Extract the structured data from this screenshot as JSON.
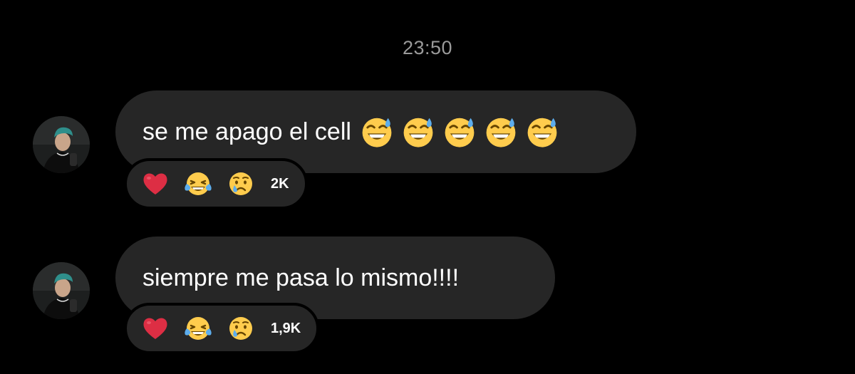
{
  "chat": {
    "timestamp": "23:50",
    "messages": [
      {
        "text": "se me apago el cell",
        "trailing_emojis": [
          "grinning-sweat",
          "grinning-sweat",
          "grinning-sweat",
          "grinning-sweat",
          "grinning-sweat"
        ],
        "reactions": [
          "red-heart",
          "tears-of-joy",
          "crying-face"
        ],
        "reaction_count": "2K"
      },
      {
        "text": "siempre me pasa lo mismo!!!!",
        "trailing_emojis": [],
        "reactions": [
          "red-heart",
          "tears-of-joy",
          "crying-face"
        ],
        "reaction_count": "1,9K"
      }
    ]
  },
  "colors": {
    "background": "#000000",
    "bubble": "#262626",
    "timestamp": "#9a9a9a",
    "text": "#ffffff"
  }
}
